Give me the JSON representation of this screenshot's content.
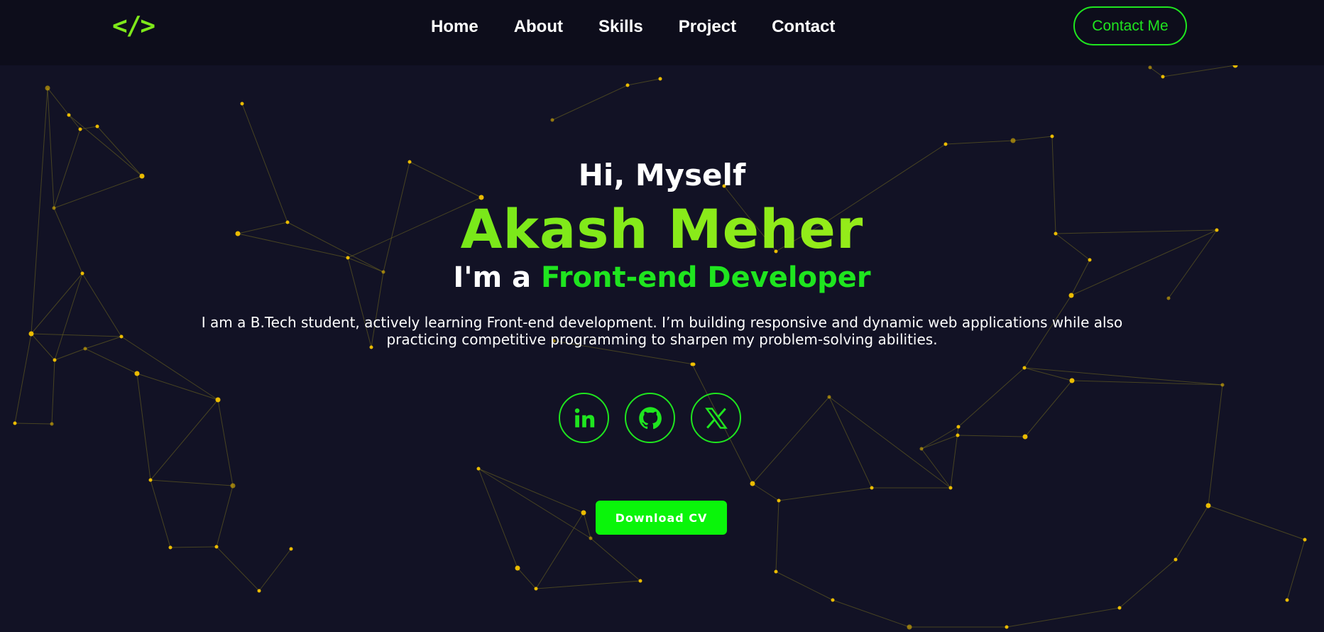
{
  "nav": {
    "logo": "</>",
    "links": [
      "Home",
      "About",
      "Skills",
      "Project",
      "Contact"
    ],
    "contact_button": "Contact Me"
  },
  "hero": {
    "greeting": "Hi, Myself",
    "name": "Akash Meher",
    "role_prefix": "I'm a",
    "role_highlight": "Front-end Developer",
    "bio_line1": "I am a B.Tech student, actively learning Front-end development. I’m building responsive and dynamic web applications while also",
    "bio_line2": "practicing competitive programming to sharpen my problem-solving abilities.",
    "download_button": "Download CV"
  },
  "socials": [
    {
      "name": "linkedin-icon"
    },
    {
      "name": "github-icon"
    },
    {
      "name": "x-twitter-icon"
    }
  ],
  "colors": {
    "background": "#121225",
    "accent_green": "#1fe51f",
    "name_gradient_start": "#57e51a",
    "name_gradient_end": "#b7ef19",
    "node_yellow": "#f5c400"
  }
}
